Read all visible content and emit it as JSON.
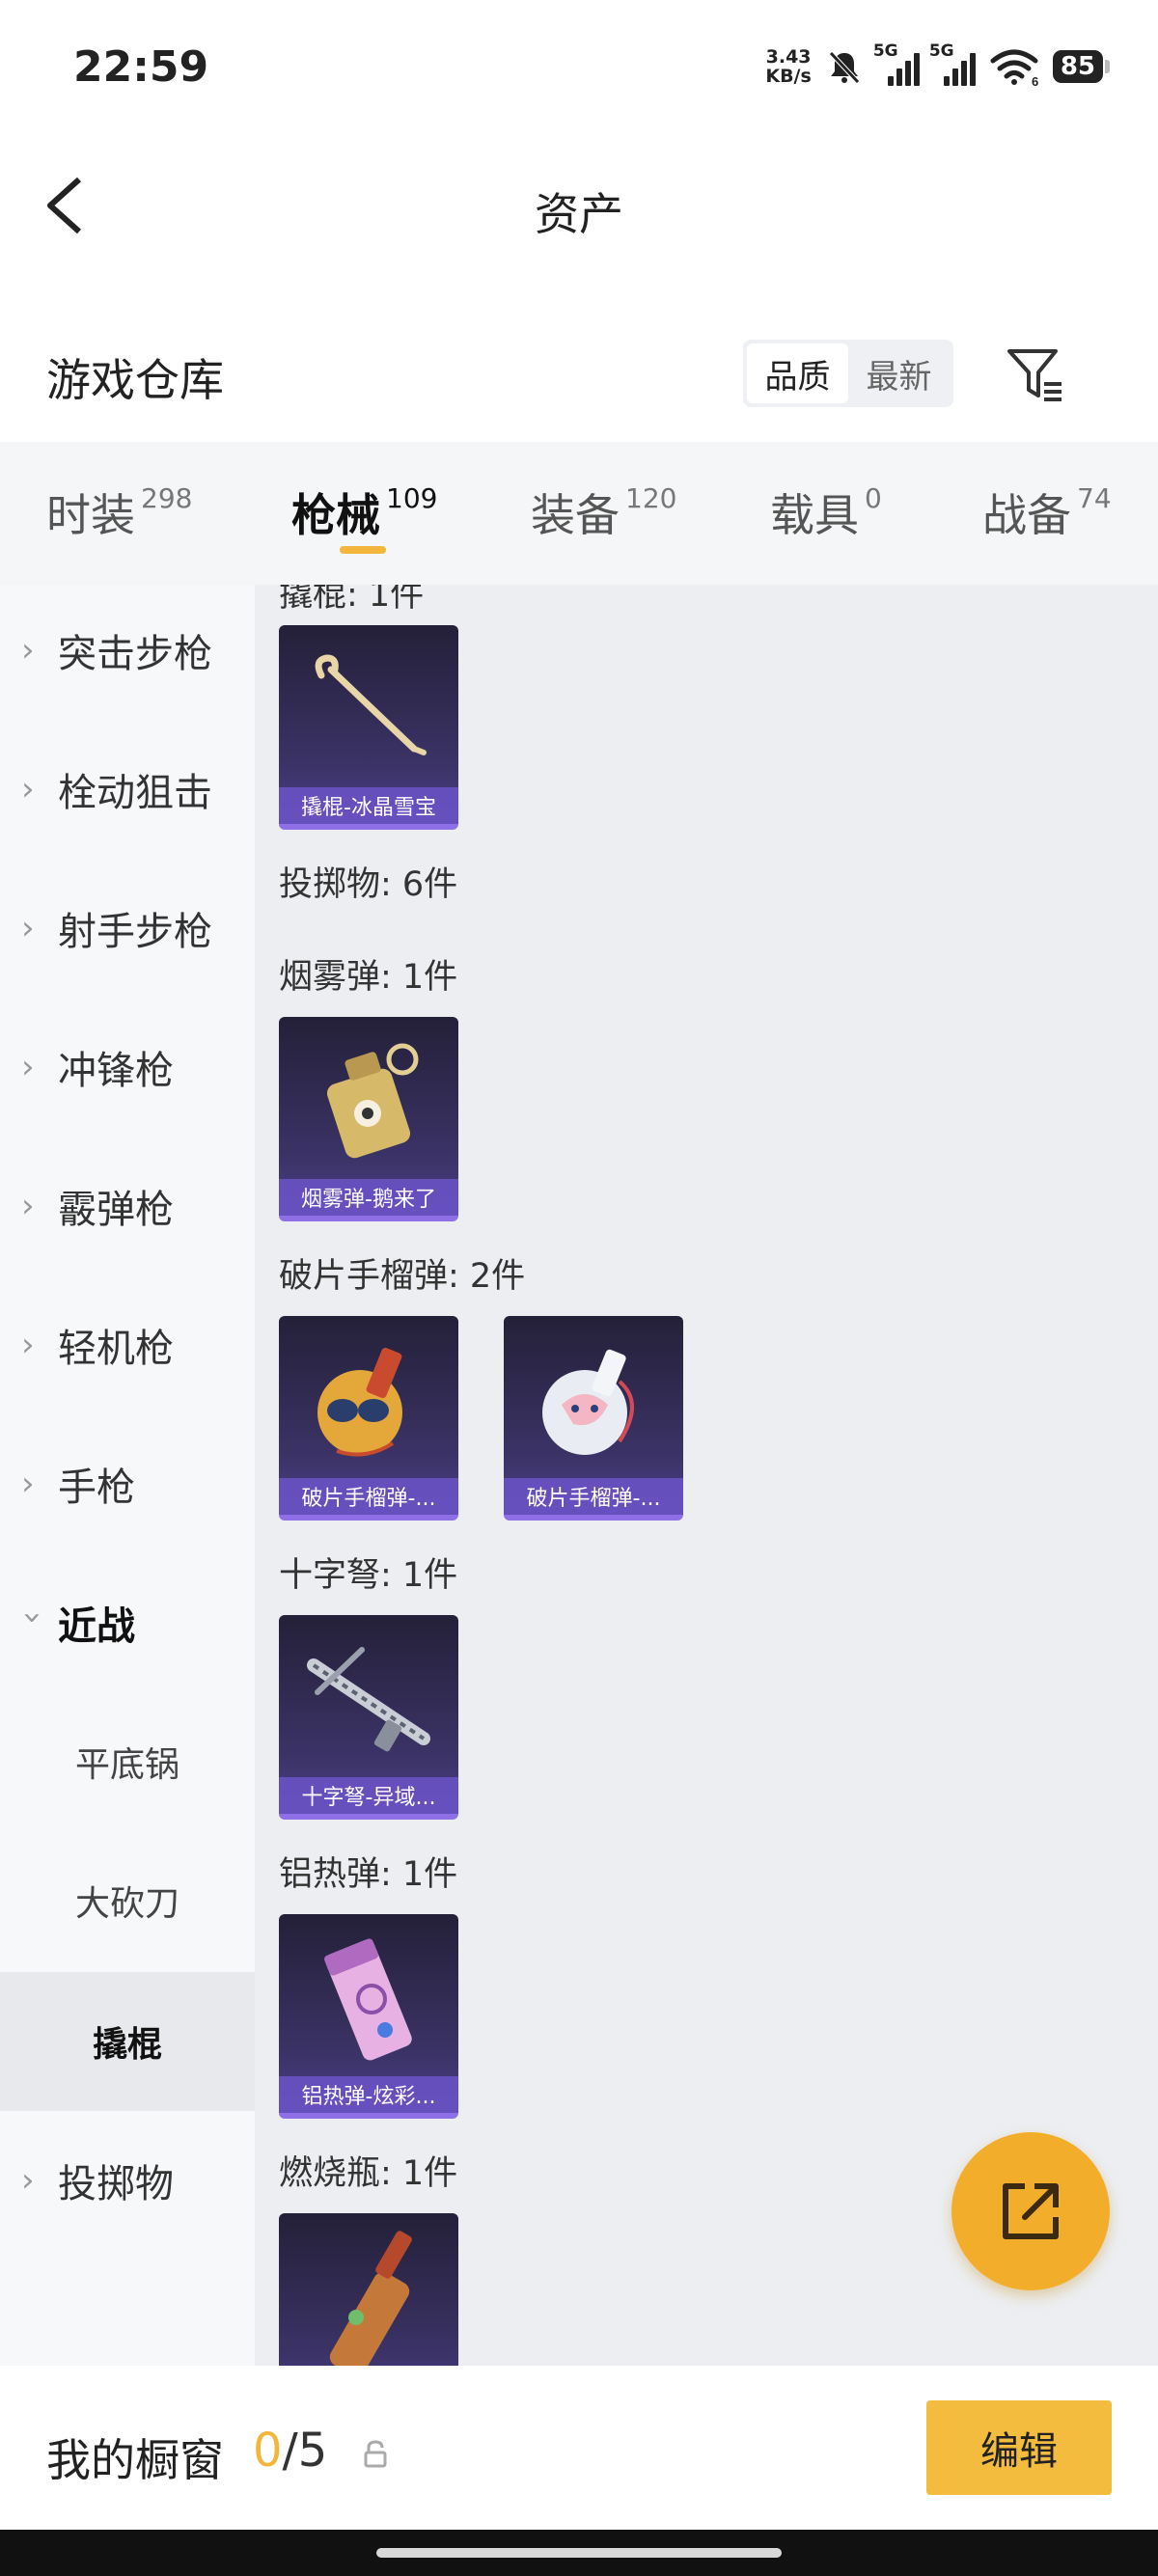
{
  "status_bar": {
    "time": "22:59",
    "net_speed_value": "3.43",
    "net_speed_unit": "KB/s",
    "network_tag_1": "5G",
    "network_tag_2": "5G",
    "wifi_tag": "6",
    "battery": "85"
  },
  "nav": {
    "title": "资产"
  },
  "warehouse": {
    "title": "游戏仓库",
    "sort_options": [
      "品质",
      "最新"
    ],
    "sort_selected": "品质"
  },
  "tabs": [
    {
      "label": "时装",
      "count": "298"
    },
    {
      "label": "枪械",
      "count": "109"
    },
    {
      "label": "装备",
      "count": "120"
    },
    {
      "label": "载具",
      "count": "0"
    },
    {
      "label": "战备",
      "count": "74"
    }
  ],
  "active_tab": "枪械",
  "sidebar": {
    "items": [
      {
        "label": "突击步枪",
        "expanded": false
      },
      {
        "label": "栓动狙击",
        "expanded": false
      },
      {
        "label": "射手步枪",
        "expanded": false
      },
      {
        "label": "冲锋枪",
        "expanded": false
      },
      {
        "label": "霰弹枪",
        "expanded": false
      },
      {
        "label": "轻机枪",
        "expanded": false
      },
      {
        "label": "手枪",
        "expanded": false
      },
      {
        "label": "近战",
        "expanded": true
      },
      {
        "label": "投掷物",
        "expanded": false
      }
    ],
    "sub_items": [
      "平底锅",
      "大砍刀",
      "撬棍"
    ],
    "selected_sub": "撬棍"
  },
  "content": {
    "partial_label": "撬棍: 1件",
    "crowbar_cards": [
      "撬棍-冰晶雪宝"
    ],
    "throwables_heading": "投掷物: 6件",
    "smoke_label": "烟雾弹: 1件",
    "smoke_cards": [
      "烟雾弹-鹅来了"
    ],
    "frag_label": "破片手榴弹: 2件",
    "frag_cards": [
      "破片手榴弹-...",
      "破片手榴弹-..."
    ],
    "crossbow_label": "十字弩: 1件",
    "crossbow_cards": [
      "十字弩-异域..."
    ],
    "thermite_label": "铝热弹: 1件",
    "thermite_cards": [
      "铝热弹-炫彩..."
    ],
    "molotov_label": "燃烧瓶: 1件"
  },
  "bottom_bar": {
    "showcase_label": "我的橱窗",
    "showcase_current": "0",
    "showcase_sep": "/",
    "showcase_max": "5",
    "edit_label": "编辑"
  },
  "colors": {
    "accent": "#f3b63a",
    "card_bg": "#2b2545",
    "card_label_bg": "#6b54c8",
    "fab": "#f2ad2a"
  }
}
